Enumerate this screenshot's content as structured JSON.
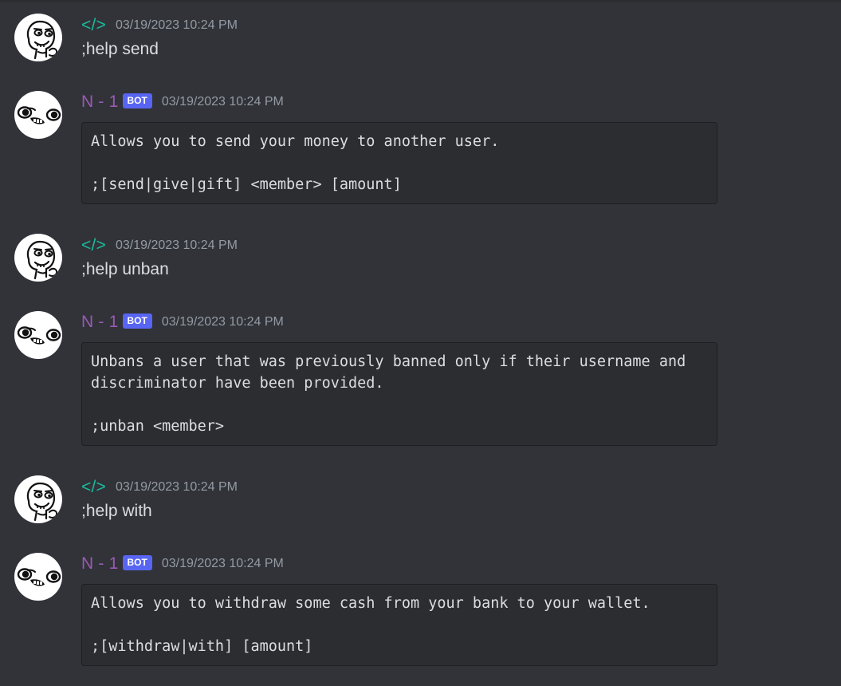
{
  "colors": {
    "background": "#313338",
    "code_background": "#2b2d31",
    "user_name_color": "#1abc9c",
    "bot_name_color": "#9b59b6",
    "bot_tag_color": "#5865f2",
    "timestamp_color": "#949ba4",
    "text_color": "#dbdee1"
  },
  "messages": [
    {
      "author": "</>",
      "timestamp": "03/19/2023 10:24 PM",
      "content": ";help send",
      "avatar_icon": "smug-face-avatar-icon"
    },
    {
      "author": "N - 1",
      "bot_tag": "BOT",
      "timestamp": "03/19/2023 10:24 PM",
      "code": "Allows you to send your money to another user.\n\n;[send|give|gift] <member> [amount]",
      "avatar_icon": "goofy-face-avatar-icon"
    },
    {
      "author": "</>",
      "timestamp": "03/19/2023 10:24 PM",
      "content": ";help unban",
      "avatar_icon": "smug-face-avatar-icon"
    },
    {
      "author": "N - 1",
      "bot_tag": "BOT",
      "timestamp": "03/19/2023 10:24 PM",
      "code": "Unbans a user that was previously banned only if their username and\ndiscriminator have been provided.\n\n;unban <member>",
      "avatar_icon": "goofy-face-avatar-icon"
    },
    {
      "author": "</>",
      "timestamp": "03/19/2023 10:24 PM",
      "content": ";help with",
      "avatar_icon": "smug-face-avatar-icon"
    },
    {
      "author": "N - 1",
      "bot_tag": "BOT",
      "timestamp": "03/19/2023 10:24 PM",
      "code": "Allows you to withdraw some cash from your bank to your wallet.\n\n;[withdraw|with] [amount]",
      "avatar_icon": "goofy-face-avatar-icon"
    }
  ]
}
